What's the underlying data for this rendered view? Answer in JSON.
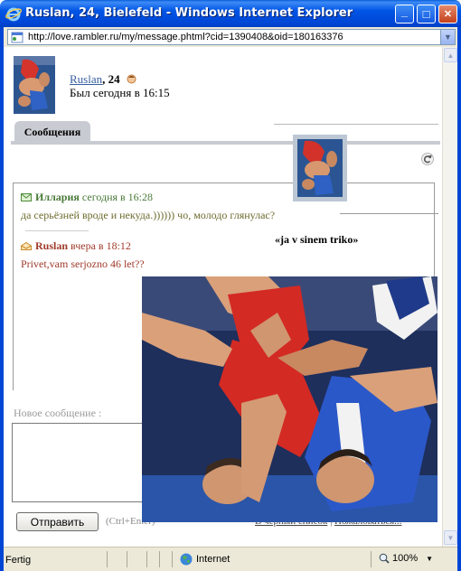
{
  "window": {
    "title": "Ruslan, 24, Bielefeld - Windows Internet Explorer",
    "minimize": "_",
    "maximize": "□",
    "close": "✕"
  },
  "address": {
    "url": "http://love.rambler.ru/my/message.phtml?cid=1390408&oid=180163376"
  },
  "profile": {
    "name": "Ruslan",
    "age": ", 24",
    "status": "Был сегодня в 16:15"
  },
  "tabs": [
    {
      "label": "Сообщения"
    }
  ],
  "messages": [
    {
      "author": "Иллария",
      "time": " сегодня в 16:28",
      "text": "да серьёзней вроде и некуда.)))))) чо, молодо глянулас?"
    },
    {
      "author": "Ruslan",
      "time": " вчера в 18:12",
      "text": "Privet,vam serjozno 46 let??"
    }
  ],
  "compose": {
    "label": "Новое сообщение  :",
    "send_button": "Отправить",
    "hint": "(Ctrl+Enter)"
  },
  "footer": {
    "blacklist": "В черный список",
    "separator": " | ",
    "complain": "Пожаловаться..."
  },
  "popup": {
    "caption": "«ja v sinem triko»"
  },
  "statusbar": {
    "status": "Fertig",
    "zone": "Internet",
    "zoom": "100%"
  },
  "colors": {
    "titlebar": "#0046d5",
    "tab": "#c9cbd2",
    "link": "#355e9e",
    "msg_green": "#4a7a3a",
    "msg_red": "#a03a2a"
  }
}
